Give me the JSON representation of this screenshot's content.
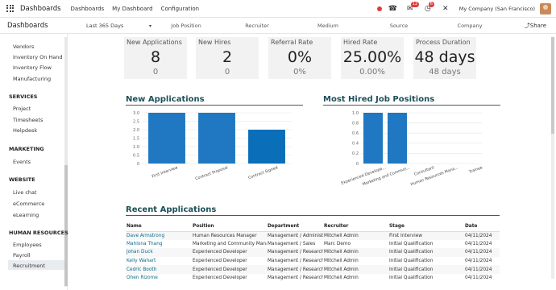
{
  "navbar": {
    "app_name": "Dashboards",
    "menu": [
      "Dashboards",
      "My Dashboard",
      "Configuration"
    ],
    "badges": {
      "chat": "12",
      "activity": "6"
    },
    "company": "My Company (San Francisco)"
  },
  "control": {
    "title": "Dashboards",
    "period": "Last 365 Days",
    "filters": [
      "Job Position",
      "Recruiter",
      "Medium",
      "Source",
      "Company"
    ],
    "share": "Share"
  },
  "sidebar": {
    "items_top": [
      "Vendors",
      "Inventory On Hand",
      "Inventory Flow",
      "Manufacturing"
    ],
    "services": {
      "label": "SERVICES",
      "items": [
        "Project",
        "Timesheets",
        "Helpdesk"
      ]
    },
    "marketing": {
      "label": "MARKETING",
      "items": [
        "Events"
      ]
    },
    "website": {
      "label": "WEBSITE",
      "items": [
        "Live chat",
        "eCommerce",
        "eLearning"
      ]
    },
    "hr": {
      "label": "HUMAN RESOURCES",
      "items": [
        "Employees",
        "Payroll",
        "Recruitment"
      ]
    }
  },
  "kpis": [
    {
      "label": "New Applications",
      "value": "8",
      "sub": "0"
    },
    {
      "label": "New Hires",
      "value": "2",
      "sub": "0"
    },
    {
      "label": "Referral Rate",
      "value": "0%",
      "sub": "0%"
    },
    {
      "label": "Hired Rate",
      "value": "25.00%",
      "sub": "0.00%"
    },
    {
      "label": "Process Duration",
      "value": "48 days",
      "sub": "48 days"
    }
  ],
  "sections": {
    "new_apps": "New Applications",
    "most_hired": "Most Hired Job Positions",
    "recent": "Recent Applications"
  },
  "chart_data": [
    {
      "type": "bar",
      "title": "New Applications",
      "categories": [
        "First Interview",
        "Contract Proposal",
        "Contract Signed"
      ],
      "values": [
        3,
        3,
        2
      ],
      "ylim": [
        0,
        3
      ],
      "yticks": [
        "0",
        "0.5",
        "1.0",
        "1.5",
        "2.0",
        "2.5",
        "3.0"
      ],
      "color": "#0a6eb9",
      "colors": [
        "#1f78c1",
        "#1f78c1",
        "#0a6eb9"
      ],
      "grid": true
    },
    {
      "type": "bar",
      "title": "Most Hired Job Positions",
      "categories": [
        "Experienced Develope...",
        "Marketing and Commun...",
        "Consultant",
        "Human Resources Mana...",
        "Trainee"
      ],
      "values": [
        1,
        1,
        0,
        0,
        0
      ],
      "ylim": [
        0,
        1
      ],
      "yticks": [
        "0",
        "0.2",
        "0.4",
        "0.6",
        "0.8",
        "1.0"
      ],
      "color": "#1f78c1",
      "grid": true
    }
  ],
  "recent": {
    "columns": [
      "Name",
      "Position",
      "Department",
      "Recruiter",
      "Stage",
      "Date"
    ],
    "rows": [
      [
        "Dave Armstrong",
        "Human Resources Manager",
        "Management / Administra",
        "Mitchell Admin",
        "First Interview",
        "04/11/2024"
      ],
      [
        "Mahlona Thang",
        "Marketing and Community Manag",
        "Management / Sales",
        "Marc Demo",
        "Initial Qualification",
        "04/11/2024"
      ],
      [
        "Johan Duck",
        "Experienced Developer",
        "Management / Research",
        "Mitchell Admin",
        "Initial Qualification",
        "04/11/2024"
      ],
      [
        "Kelly Wahart",
        "Experienced Developer",
        "Management / Research",
        "Mitchell Admin",
        "Initial Qualification",
        "04/11/2024"
      ],
      [
        "Cedric Booth",
        "Experienced Developer",
        "Management / Research",
        "Mitchell Admin",
        "Initial Qualification",
        "04/11/2024"
      ],
      [
        "Ohen Rizome",
        "Experienced Developer",
        "Management / Research",
        "Mitchell Admin",
        "Initial Qualification",
        "04/11/2024"
      ]
    ]
  }
}
